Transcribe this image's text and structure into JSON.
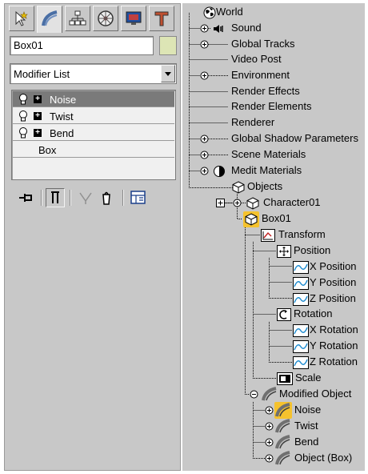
{
  "command_panel": {
    "tabs": [
      "create-icon",
      "modify-icon",
      "hierarchy-icon",
      "motion-icon",
      "display-icon",
      "utilities-icon"
    ],
    "object_name": "Box01",
    "object_color": "#dde5b5",
    "modifier_list_label": "Modifier List",
    "stack": [
      {
        "label": "Noise",
        "selected": true
      },
      {
        "label": "Twist",
        "selected": false
      },
      {
        "label": "Bend",
        "selected": false
      },
      {
        "label": "Box",
        "selected": false
      }
    ]
  },
  "track_view": {
    "nodes": [
      {
        "label": "World",
        "icon": "world-icon"
      },
      {
        "label": "Sound",
        "icon": "sound-icon"
      },
      {
        "label": "Global Tracks"
      },
      {
        "label": "Video Post"
      },
      {
        "label": "Environment"
      },
      {
        "label": "Render Effects"
      },
      {
        "label": "Render Elements"
      },
      {
        "label": "Renderer"
      },
      {
        "label": "Global Shadow Parameters"
      },
      {
        "label": "Scene Materials"
      },
      {
        "label": "Medit Materials",
        "icon": "material-sphere-icon"
      },
      {
        "label": "Objects",
        "icon": "objects-icon"
      },
      {
        "label": "Character01",
        "icon": "object-icon"
      },
      {
        "label": "Box01",
        "icon": "object-icon"
      },
      {
        "label": "Transform",
        "icon": "transform-icon"
      },
      {
        "label": "Position",
        "icon": "position-icon"
      },
      {
        "label": "X Position",
        "icon": "curve-icon"
      },
      {
        "label": "Y Position",
        "icon": "curve-icon"
      },
      {
        "label": "Z Position",
        "icon": "curve-icon"
      },
      {
        "label": "Rotation",
        "icon": "rotation-icon"
      },
      {
        "label": "X Rotation",
        "icon": "curve-icon"
      },
      {
        "label": "Y Rotation",
        "icon": "curve-icon"
      },
      {
        "label": "Z Rotation",
        "icon": "curve-icon"
      },
      {
        "label": "Scale",
        "icon": "scale-icon"
      },
      {
        "label": "Modified Object",
        "icon": "modifier-icon"
      },
      {
        "label": "Noise",
        "icon": "modifier-icon"
      },
      {
        "label": "Twist",
        "icon": "modifier-icon"
      },
      {
        "label": "Bend",
        "icon": "modifier-icon"
      },
      {
        "label": "Object (Box)",
        "icon": "modifier-icon"
      }
    ]
  },
  "colors": {
    "highlight": "#f5c22e",
    "panel": "#c8c8c8"
  }
}
